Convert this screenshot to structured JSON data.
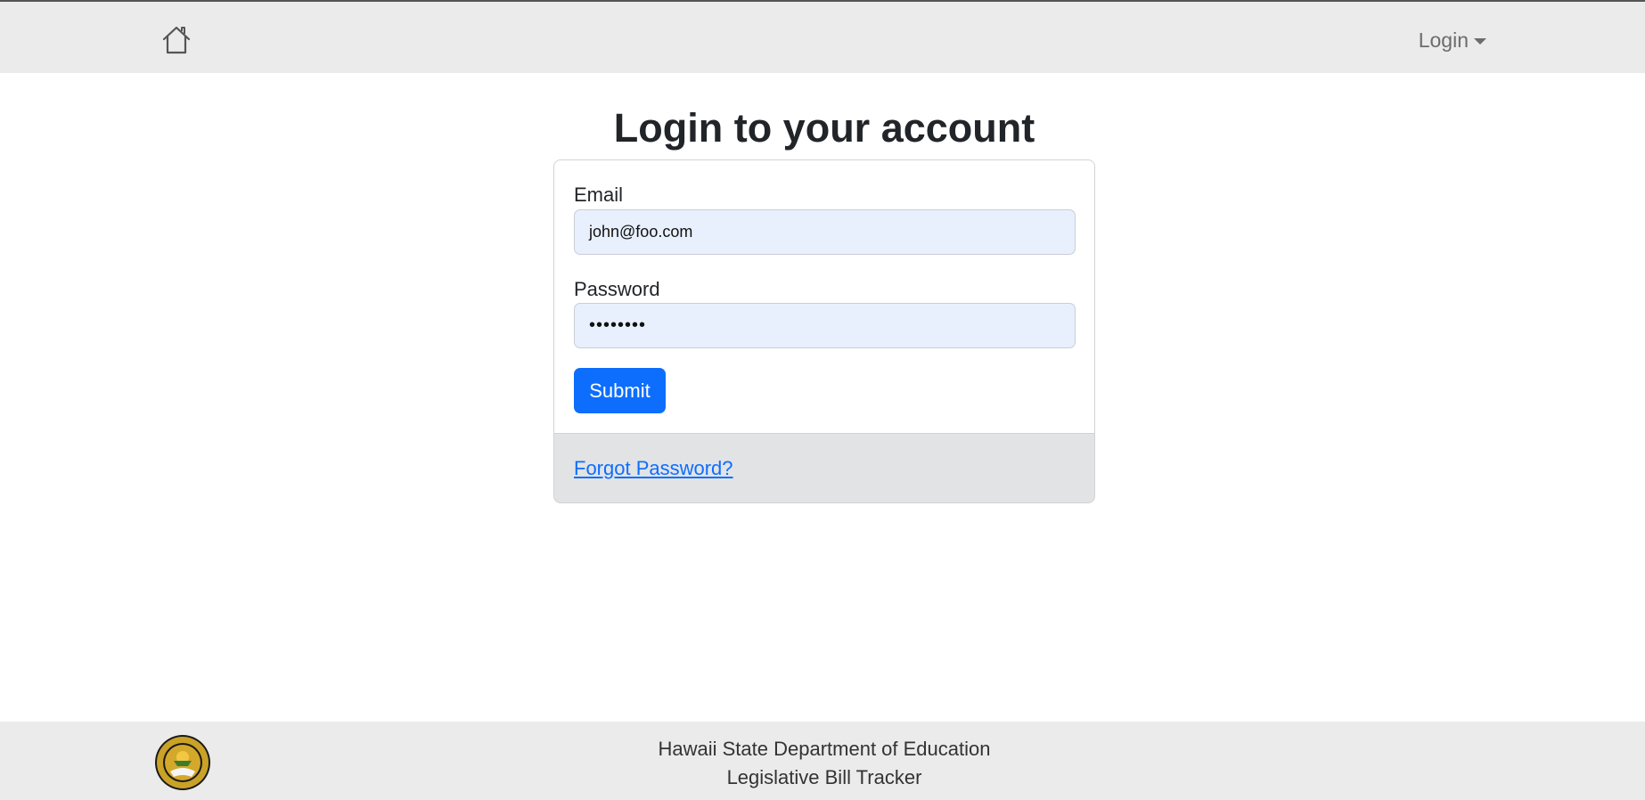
{
  "navbar": {
    "home_icon": "home-icon",
    "login_menu_label": "Login"
  },
  "main": {
    "title": "Login to your account",
    "form": {
      "email_label": "Email",
      "email_value": "john@foo.com",
      "password_label": "Password",
      "password_value": "••••••••",
      "submit_label": "Submit"
    },
    "forgot_password_label": "Forgot Password?"
  },
  "footer": {
    "seal_icon": "state-seal-icon",
    "line1": "Hawaii State Department of Education",
    "line2": "Legislative Bill Tracker"
  },
  "colors": {
    "navbar_bg": "#ebebeb",
    "primary": "#0d6efd",
    "input_bg": "#e8f0fe",
    "card_footer_bg": "#e2e3e5"
  }
}
